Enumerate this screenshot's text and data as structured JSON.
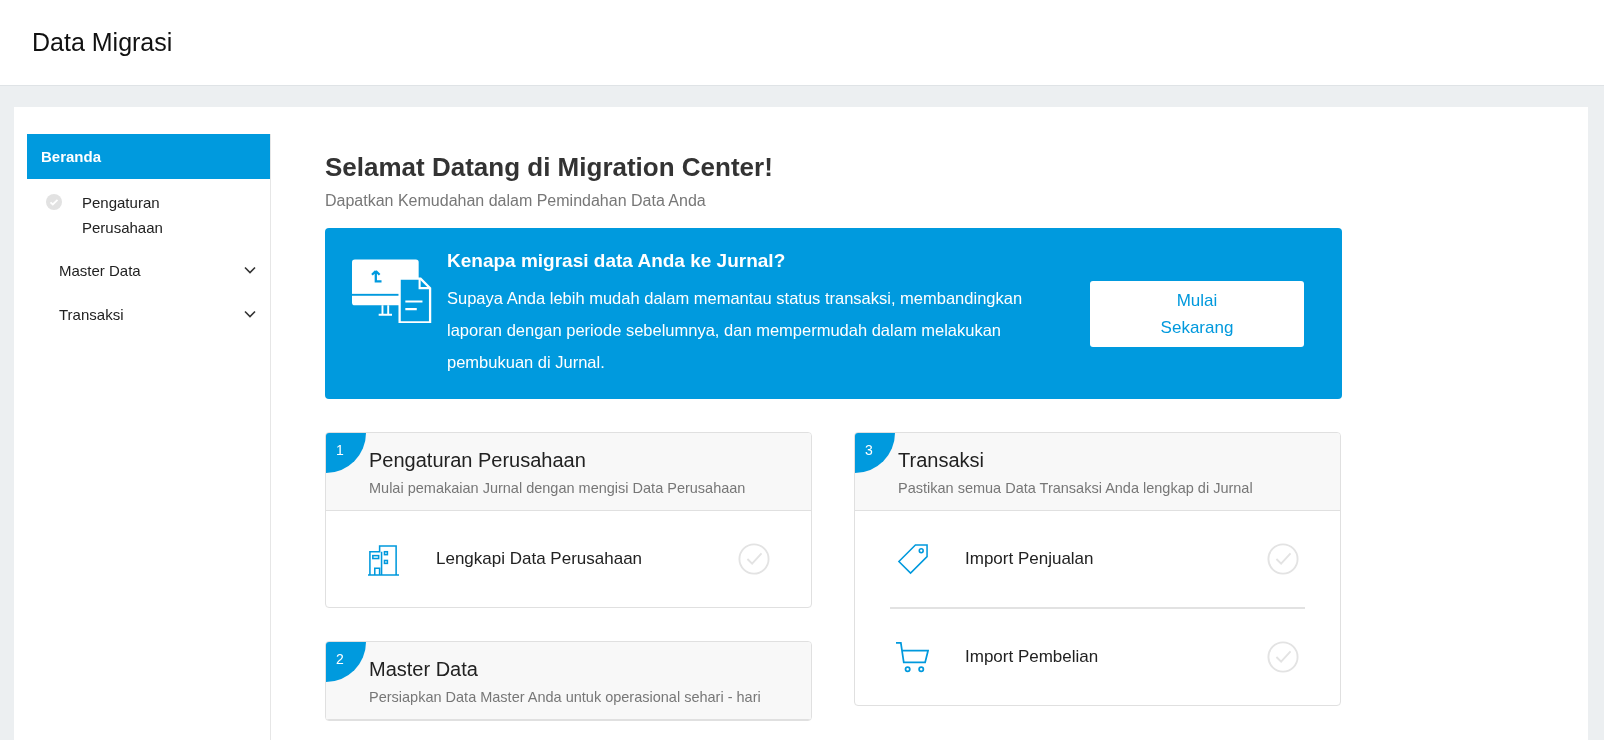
{
  "header": {
    "title": "Data Migrasi"
  },
  "sidebar": {
    "items": [
      {
        "kind": "home",
        "label": "Beranda",
        "selected": true
      },
      {
        "kind": "step",
        "label": "Pengaturan Perusahaan",
        "selected": false,
        "done": false
      },
      {
        "kind": "group",
        "label": "Master Data",
        "selected": false,
        "expanded": false
      },
      {
        "kind": "group",
        "label": "Transaksi",
        "selected": false,
        "expanded": false
      }
    ]
  },
  "welcome": {
    "title": "Selamat Datang di Migration Center!",
    "subtitle": "Dapatkan Kemudahan dalam Pemindahan Data Anda"
  },
  "banner": {
    "title": "Kenapa migrasi data Anda ke Jurnal?",
    "text": "Supaya Anda lebih mudah dalam memantau status transaksi, membandingkan laporan dengan periode sebelumnya, dan mempermudah dalam melakukan pembukuan di Jurnal.",
    "button": "Mulai Sekarang"
  },
  "columns": [
    {
      "cards": [
        {
          "number": "1",
          "title": "Pengaturan Perusahaan",
          "subtitle": "Mulai pemakaian Jurnal dengan mengisi Data Perusahaan",
          "tasks": [
            {
              "kind": "building",
              "label": "Lengkapi Data Perusahaan",
              "done": false
            }
          ]
        },
        {
          "number": "2",
          "title": "Master Data",
          "subtitle": "Persiapkan Data Master Anda untuk operasional sehari - hari"
        }
      ]
    },
    {
      "cards": [
        {
          "number": "3",
          "title": "Transaksi",
          "subtitle": "Pastikan semua Data Transaksi Anda lengkap di Jurnal",
          "tasks": [
            {
              "kind": "tag",
              "label": "Import Penjualan",
              "done": false
            },
            {
              "kind": "cart",
              "label": "Import Pembelian",
              "done": false
            }
          ]
        }
      ]
    }
  ]
}
